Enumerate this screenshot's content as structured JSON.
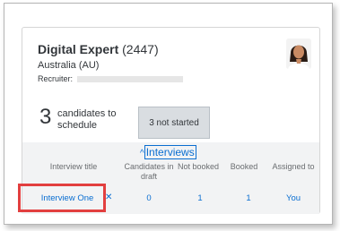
{
  "job": {
    "title": "Digital Expert",
    "id": "(2447)",
    "location": "Australia (AU)",
    "recruiter_label": "Recruiter:"
  },
  "summary": {
    "count": "3",
    "count_label": "candidates to schedule",
    "not_started_button": "3 not started"
  },
  "interviews": {
    "toggle_label": "Interviews",
    "columns": [
      "Interview title",
      "Candidates in draft",
      "Not booked",
      "Booked",
      "Assigned to"
    ],
    "rows": [
      {
        "title": "Interview One",
        "candidates_in_draft": "0",
        "not_booked": "1",
        "booked": "1",
        "assigned_to": "You"
      }
    ]
  },
  "colors": {
    "link": "#0a6ed1",
    "highlight": "#e23f3f",
    "table_bg": "#f2f3f4"
  }
}
